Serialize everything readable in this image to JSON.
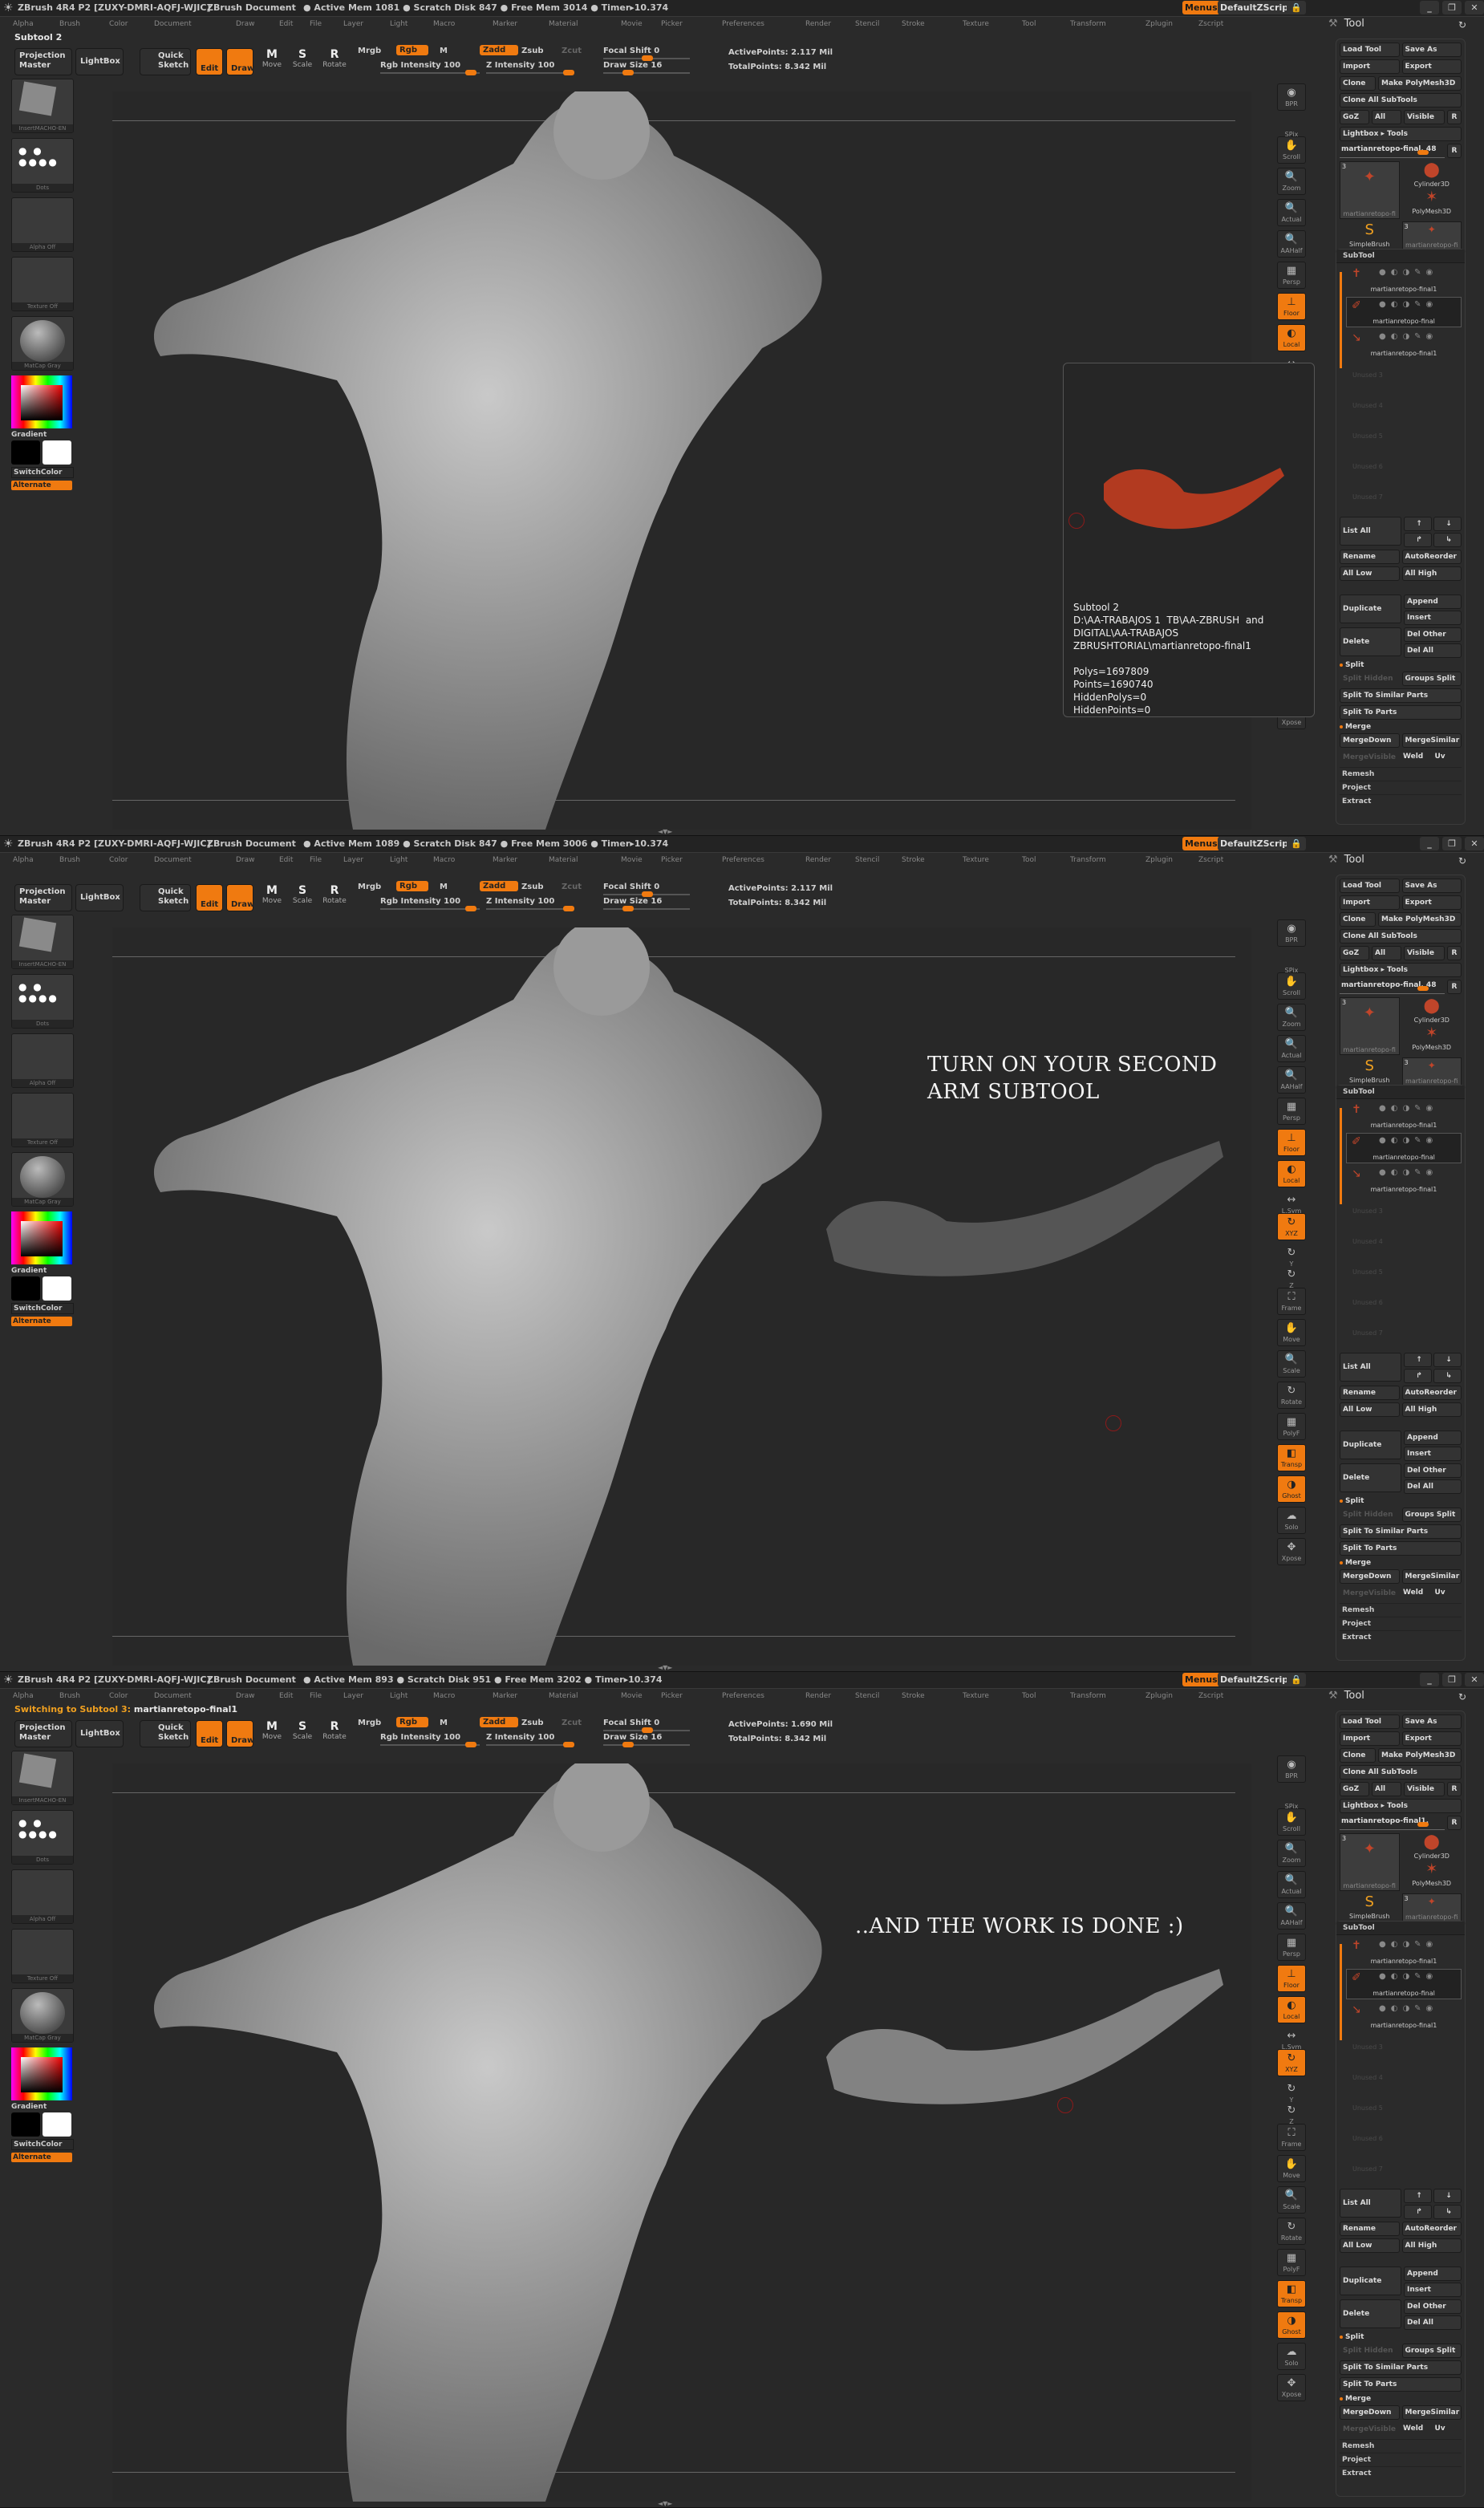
{
  "colors": {
    "accent": "#f07a10",
    "background": "#2a2a2a",
    "clay": "#c0452a"
  },
  "common": {
    "app_title": "ZBrush 4R4 P2 [ZUXY-DMRI-AQFJ-WJIC]",
    "document_title": "ZBrush Document",
    "menus_button": "Menus",
    "default_script": "DefaultZScript",
    "menu_items": [
      "Alpha",
      "Brush",
      "Color",
      "Document",
      "Draw",
      "Edit",
      "File",
      "Layer",
      "Light",
      "Macro",
      "Marker",
      "Material",
      "Movie",
      "Picker",
      "Preferences",
      "Render",
      "Stencil",
      "Stroke",
      "Texture",
      "Tool",
      "Transform",
      "Zplugin",
      "Zscript"
    ],
    "toolbar": {
      "projection_master": "Projection Master",
      "lightbox": "LightBox",
      "quick_sketch": "Quick Sketch",
      "edit": "Edit",
      "draw": "Draw",
      "move": "Move",
      "scale": "Scale",
      "rotate": "Rotate",
      "mrgb": "Mrgb",
      "rgb": "Rgb",
      "m": "M",
      "rgb_intensity": "Rgb Intensity 100",
      "zadd": "Zadd",
      "zsub": "Zsub",
      "zcut": "Zcut",
      "z_intensity": "Z Intensity 100",
      "focal_shift": "Focal Shift 0",
      "draw_size": "Draw Size 16",
      "rgb_intensity_value": 100,
      "z_intensity_value": 100,
      "focal_shift_value": 0,
      "draw_size_value": 16
    },
    "shelf": {
      "brush": "InsertMACHO-EN",
      "stroke": "Dots",
      "alpha": "Alpha Off",
      "texture": "Texture Off",
      "material": "MatCap Gray",
      "gradient": "Gradient",
      "switch_color": "SwitchColor",
      "alternate": "Alternate"
    },
    "right_toolbar": [
      "BPR",
      "SPix",
      "Scroll",
      "Zoom",
      "Actual",
      "AAHalf",
      "Persp",
      "Floor",
      "Local",
      "L.Sym",
      "XYZ",
      "Y",
      "Z",
      "Frame",
      "Move",
      "Scale",
      "Rotate",
      "PolyF",
      "Transp",
      "Ghost",
      "Solo",
      "Xpose"
    ],
    "tool_panel": {
      "title": "Tool",
      "load_tool": "Load Tool",
      "save_as": "Save As",
      "import": "Import",
      "export": "Export",
      "clone": "Clone",
      "make_polymesh": "Make PolyMesh3D",
      "clone_all": "Clone All SubTools",
      "goz": "GoZ",
      "all": "All",
      "visible": "Visible",
      "r": "R",
      "lightbox_tools": "Lightbox ▸ Tools",
      "tools": [
        {
          "count": "3",
          "name": "martianretopo-fi"
        },
        {
          "name": "Cylinder3D"
        },
        {
          "name": "PolyMesh3D"
        },
        {
          "name": "SimpleBrush"
        },
        {
          "count": "3",
          "name": "martianretopo-fi"
        }
      ]
    },
    "subtool_panel": {
      "title": "SubTool",
      "items": [
        "martianretopo-final1",
        "martianretopo-final",
        "martianretopo-final1"
      ],
      "unused": [
        "Unused 3",
        "Unused 4",
        "Unused 5",
        "Unused 6",
        "Unused 7"
      ],
      "list_all": "List All",
      "rename": "Rename",
      "auto_reorder": "AutoReorder",
      "all_low": "All Low",
      "all_high": "All High",
      "duplicate": "Duplicate",
      "append": "Append",
      "insert": "Insert",
      "delete": "Delete",
      "del_other": "Del Other",
      "del_all": "Del All",
      "split": "Split",
      "split_hidden": "Split Hidden",
      "groups_split": "Groups Split",
      "split_similar": "Split To Similar Parts",
      "split_parts": "Split To Parts",
      "merge": "Merge",
      "merge_down": "MergeDown",
      "merge_similar": "MergeSimilar",
      "merge_visible": "MergeVisible",
      "weld": "Weld",
      "uv": "Uv",
      "remesh": "Remesh",
      "project": "Project",
      "extract": "Extract"
    }
  },
  "panels": [
    {
      "mem": "● Active Mem 1081 ● Scratch Disk 847 ● Free Mem 3014 ● Timer▸10.374",
      "status": "Subtool 2",
      "status_prefix": "",
      "active_points": "ActivePoints: 2.117 Mil",
      "total_points": "TotalPoints: 8.342 Mil",
      "tool_name": "martianretopo-final. 48",
      "annotation": "",
      "popup": {
        "info": "Subtool 2\nD:\\AA-TRABAJOS 1  TB\\AA-ZBRUSH  and\nDIGITAL\\AA-TRABAJOS\nZBRUSHTORIAL\\martianretopo-final1\n\nPolys=1697809\nPoints=1690740\nHiddenPolys=0\nHiddenPoints=0"
      }
    },
    {
      "mem": "● Active Mem 1089 ● Scratch Disk 847 ● Free Mem 3006 ● Timer▸10.374",
      "status": "",
      "status_prefix": "",
      "active_points": "ActivePoints: 2.117 Mil",
      "total_points": "TotalPoints: 8.342 Mil",
      "tool_name": "martianretopo-final. 48",
      "annotation": "TURN ON YOUR SECOND\nARM SUBTOOL"
    },
    {
      "mem": "● Active Mem 893 ● Scratch Disk 951 ● Free Mem 3202 ● Timer▸10.374",
      "status": "martianretopo-final1",
      "status_prefix": "Switching to Subtool 3:",
      "active_points": "ActivePoints: 1.690 Mil",
      "total_points": "TotalPoints: 8.342 Mil",
      "tool_name": "martianretopo-final1.",
      "annotation": "..AND THE WORK IS DONE :)"
    }
  ]
}
